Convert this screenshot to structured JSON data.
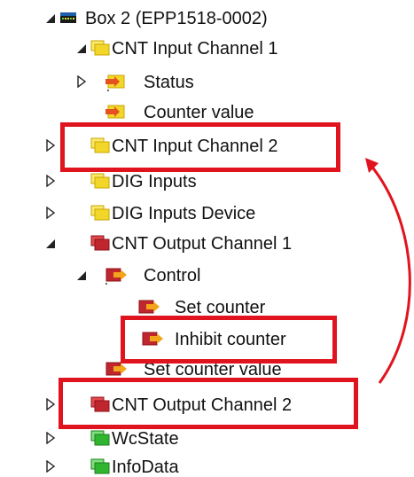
{
  "tree": {
    "box": {
      "label": "Box 2 (EPP1518-0002)",
      "expanded": true,
      "icon": "device-box-icon"
    },
    "cnt_input_1": {
      "label": "CNT Input Channel 1",
      "expanded": true,
      "icon": "input-folder-icon",
      "color": "#f2d72a"
    },
    "status": {
      "label": "Status",
      "expanded": false,
      "icon": "input-variable-icon"
    },
    "counter_value": {
      "label": "Counter value",
      "icon": "input-variable-icon"
    },
    "cnt_input_2": {
      "label": "CNT Input Channel 2",
      "expanded": false,
      "icon": "input-folder-icon",
      "highlighted": true
    },
    "dig_inputs": {
      "label": "DIG Inputs",
      "expanded": false,
      "icon": "input-folder-icon"
    },
    "dig_inputs_device": {
      "label": "DIG Inputs Device",
      "expanded": false,
      "icon": "input-folder-icon"
    },
    "cnt_output_1": {
      "label": "CNT Output Channel 1",
      "expanded": true,
      "icon": "output-folder-icon",
      "color": "#c0262d"
    },
    "control": {
      "label": "Control",
      "expanded": true,
      "icon": "output-variable-icon"
    },
    "set_counter": {
      "label": "Set counter",
      "icon": "output-variable-icon"
    },
    "inhibit_counter": {
      "label": "Inhibit counter",
      "icon": "output-variable-icon",
      "highlighted": true
    },
    "set_counter_value": {
      "label": "Set counter value",
      "icon": "output-variable-icon"
    },
    "cnt_output_2": {
      "label": "CNT Output Channel 2",
      "expanded": false,
      "icon": "output-folder-icon",
      "highlighted": true
    },
    "wcstate": {
      "label": "WcState",
      "expanded": false,
      "icon": "status-folder-icon",
      "color": "#2fb52f"
    },
    "infodata": {
      "label": "InfoData",
      "expanded": false,
      "icon": "status-folder-icon"
    }
  },
  "annotation": {
    "highlight_color": "#e0141e",
    "arrow": "from CNT Output Channel 2 to CNT Input Channel 2"
  }
}
